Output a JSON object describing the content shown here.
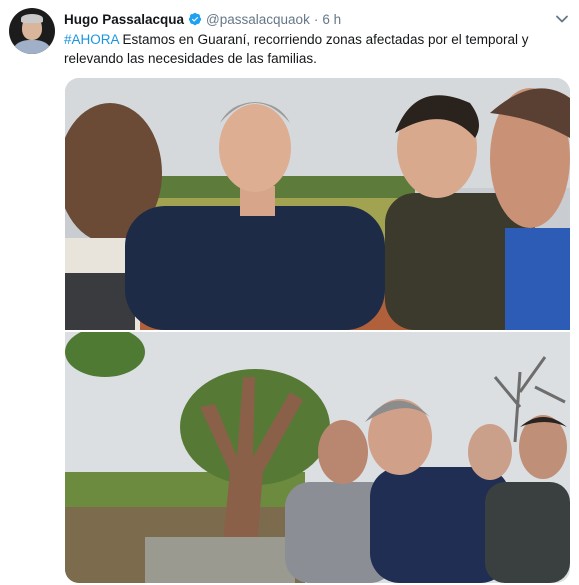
{
  "tweet": {
    "author_name": "Hugo Passalacqua",
    "handle": "@passalacquaok",
    "separator": "·",
    "time": "6 h",
    "hashtag": "#AHORA",
    "text_rest": " Estamos en Guaraní, recorriendo zonas afectadas por el temporal y relevando las necesidades de las familias."
  },
  "colors": {
    "link": "#1b95e0",
    "verified": "#1da1f2",
    "secondary_text": "#657786"
  },
  "icons": {
    "verified": "verified-badge-icon",
    "menu": "chevron-down-icon"
  }
}
